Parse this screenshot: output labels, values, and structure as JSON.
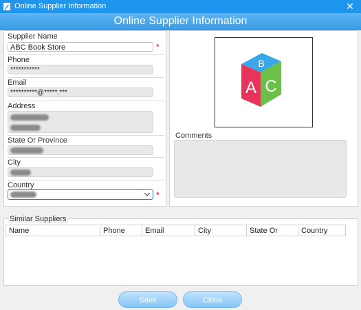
{
  "window": {
    "title": "Online Supplier Information",
    "close_symbol": "✕"
  },
  "header": {
    "title": "Online Supplier Information"
  },
  "form": {
    "supplier_name_label": "Supplier Name",
    "supplier_name_value": "ABC Book Store",
    "phone_label": "Phone",
    "phone_value": "***********",
    "email_label": "Email",
    "email_value": "**********@*****.***",
    "address_label": "Address",
    "state_label": "State Or Province",
    "city_label": "City",
    "country_label": "Country",
    "required_marker": "*"
  },
  "comments": {
    "label": "Comments"
  },
  "similar_suppliers": {
    "label": "Similar Suppliers",
    "columns": [
      "Name",
      "Phone",
      "Email",
      "City",
      "State Or",
      "Country"
    ]
  },
  "buttons": {
    "save": "Save",
    "close": "Close"
  },
  "logo": {
    "letters": [
      "B",
      "A",
      "C"
    ]
  },
  "colors": {
    "titlebar": "#1e96f0",
    "header": "#3a9be6",
    "required": "#d60000"
  }
}
